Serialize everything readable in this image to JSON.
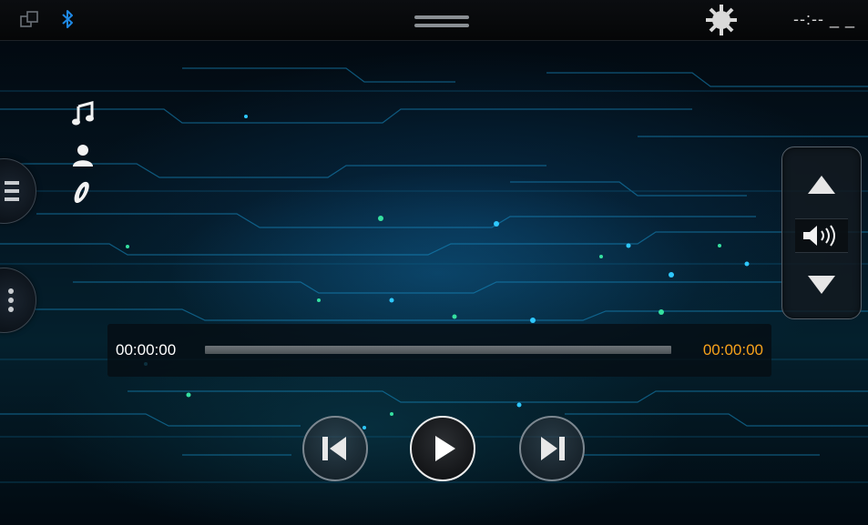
{
  "status_bar": {
    "clock": "--:-- _ _",
    "icons": [
      "multiwindow-icon",
      "bluetooth-icon",
      "drag-handle-icon",
      "brightness-icon"
    ]
  },
  "side_tabs": {
    "menu_icon": "hamburger-menu-icon",
    "more_icon": "vertical-dots-icon"
  },
  "track_info": {
    "icons": [
      "music-note-icon",
      "artist-icon",
      "album-icon"
    ]
  },
  "volume": {
    "up_icon": "triangle-up-icon",
    "speaker_icon": "speaker-icon",
    "down_icon": "triangle-down-icon"
  },
  "playback": {
    "elapsed": "00:00:00",
    "total": "00:00:00",
    "progress": 0
  },
  "controls": {
    "prev_icon": "skip-previous-icon",
    "play_icon": "play-icon",
    "next_icon": "skip-next-icon"
  },
  "colors": {
    "accent_orange": "#f7a21b",
    "bluetooth_blue": "#1e88e5",
    "background_dark": "#041521",
    "circuit_cyan": "#17c4ff"
  }
}
